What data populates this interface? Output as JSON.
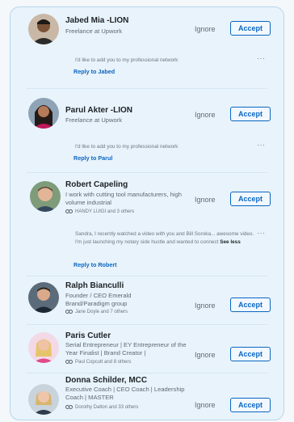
{
  "invitations": [
    {
      "name": "Jabed Mia -LION",
      "headline": "Freelance at Upwork",
      "mutual": "",
      "message": "I'd like to add you to my professional network",
      "message_action": "",
      "reply_label": "Reply to Jabed",
      "ignore_label": "Ignore",
      "accept_label": "Accept"
    },
    {
      "name": "Parul Akter -LION",
      "headline": "Freelance at Upwork",
      "mutual": "",
      "message": "I'd like to add you to my professional network",
      "message_action": "",
      "reply_label": "Reply to Parul",
      "ignore_label": "Ignore",
      "accept_label": "Accept"
    },
    {
      "name": "Robert Capeling",
      "headline": "I work with cutting tool manufacturers, high volume industrial",
      "mutual": "HANDY LUIGI and 3 others",
      "message": "Sandra, I recently watched a video with you and Bill Soroka... awesome video. I'm just launching my notary side hustle and wanted to connect",
      "message_action": "See less",
      "reply_label": "Reply to Robert",
      "ignore_label": "Ignore",
      "accept_label": "Accept"
    },
    {
      "name": "Ralph Bianculli",
      "headline": "Founder / CEO Emerald Brand/Paradigm group",
      "mutual": "Jane Doyle and 7 others",
      "ignore_label": "Ignore",
      "accept_label": "Accept"
    },
    {
      "name": "Paris Cutler",
      "headline": "Serial Entrepreneur | EY Entrepreneur of the Year Finalist | Brand Creator |",
      "mutual": "Paul Copcutt and 8 others",
      "ignore_label": "Ignore",
      "accept_label": "Accept"
    },
    {
      "name": "Donna Schilder, MCC",
      "headline": "Executive Coach | CEO Coach | Leadership Coach | MASTER",
      "mutual": "Dorothy Dalton and 33 others",
      "ignore_label": "Ignore",
      "accept_label": "Accept"
    }
  ],
  "more_label": "···",
  "colors": {
    "accent": "#0a66c2",
    "card_background": "#e8f3fb",
    "border": "#b9d6ea"
  }
}
